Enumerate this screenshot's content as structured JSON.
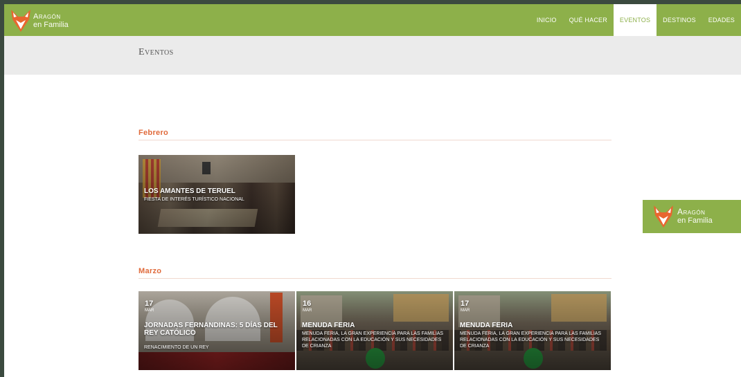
{
  "brand": {
    "line1": "Aragón",
    "line2": "en Familia",
    "color": "#8db04a",
    "accent": "#e06a3b"
  },
  "nav": {
    "items": [
      {
        "label": "Inicio",
        "active": false
      },
      {
        "label": "Qué hacer",
        "active": false
      },
      {
        "label": "Eventos",
        "active": true
      },
      {
        "label": "Destinos",
        "active": false
      },
      {
        "label": "Edades",
        "active": false
      }
    ]
  },
  "page": {
    "title": "Eventos"
  },
  "sections": [
    {
      "month": "Febrero",
      "events": [
        {
          "date": "",
          "date_month": "",
          "title": "Los Amantes de Teruel",
          "subtitle": "Fiesta de interés turístico nacional"
        }
      ]
    },
    {
      "month": "Marzo",
      "events": [
        {
          "date": "17",
          "date_month": "mar",
          "title": "Jornadas Fernandinas: 5 días del Rey Católico",
          "subtitle": "Renacimiento de un rey"
        },
        {
          "date": "16",
          "date_month": "mar",
          "title": "Menuda Feria",
          "subtitle": "Menuda feria, la gran experiencia para las familias relacionadas con la educación y sus necesidades de crianza"
        },
        {
          "date": "17",
          "date_month": "mar",
          "title": "Menuda Feria",
          "subtitle": "Menuda feria, la gran experiencia para las familias relacionadas con la educación y sus necesidades de crianza"
        }
      ]
    }
  ],
  "float_logo": {
    "line1": "Aragón",
    "line2": "en Familia"
  }
}
